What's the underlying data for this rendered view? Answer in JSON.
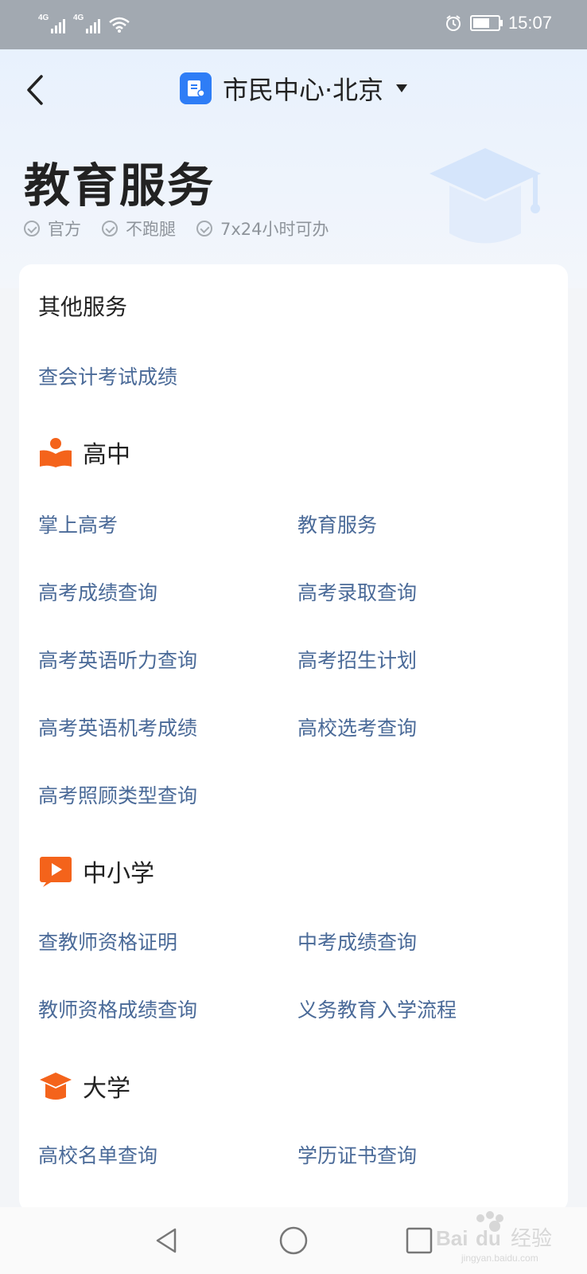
{
  "status_bar": {
    "signal1_label": "4G",
    "signal2_label": "4G",
    "time": "15:07",
    "icons": [
      "signal-icon",
      "signal-icon",
      "wifi-icon",
      "alarm-icon",
      "battery-icon"
    ]
  },
  "header": {
    "back_icon": "chevron-left-icon",
    "app_title": "市民中心·北京",
    "dropdown_icon": "caret-down-icon"
  },
  "page": {
    "title": "教育服务",
    "badges": [
      "官方",
      "不跑腿",
      "7x24小时可办"
    ]
  },
  "sections": {
    "other": {
      "title": "其他服务",
      "items": [
        "查会计考试成绩"
      ]
    },
    "high_school": {
      "title": "高中",
      "icon": "book-reader-icon",
      "items": [
        "掌上高考",
        "教育服务",
        "高考成绩查询",
        "高考录取查询",
        "高考英语听力查询",
        "高考招生计划",
        "高考英语机考成绩",
        "高校选考查询",
        "高考照顾类型查询"
      ]
    },
    "k12": {
      "title": "中小学",
      "icon": "video-play-icon",
      "items": [
        "查教师资格证明",
        "中考成绩查询",
        "教师资格成绩查询",
        "义务教育入学流程"
      ]
    },
    "university": {
      "title": "大学",
      "icon": "graduation-cap-icon",
      "items": [
        "高校名单查询",
        "学历证书查询"
      ]
    }
  },
  "watermark": {
    "brand": "Baidu",
    "cn": "经验",
    "url": "jingyan.baidu.com"
  },
  "colors": {
    "accent_blue": "#2e7df6",
    "link_blue": "#4a6a98",
    "section_orange": "#f4631b"
  }
}
